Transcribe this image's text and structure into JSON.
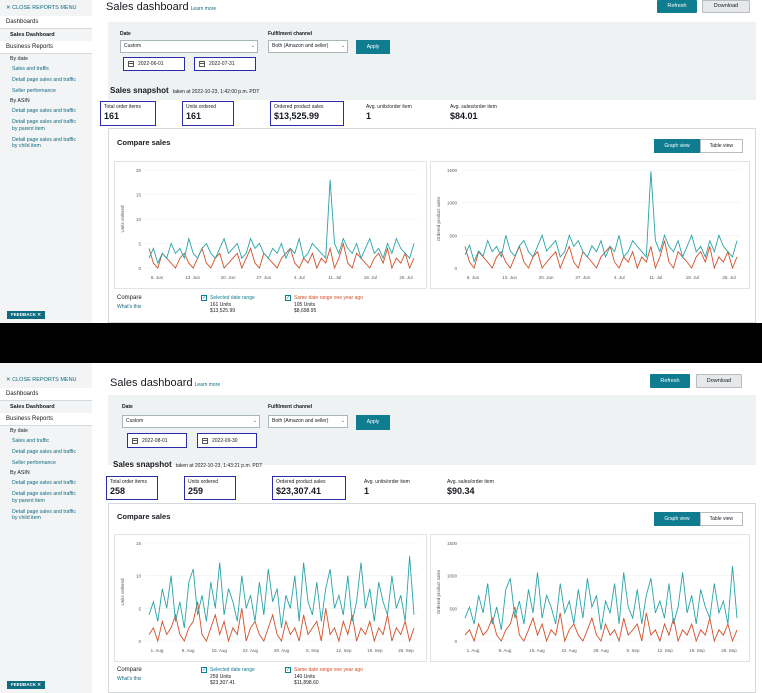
{
  "colors": {
    "teal": "#2aa3a8",
    "orange": "#d1502a",
    "accent": "#0f7c90",
    "highlight": "#2b2aa8"
  },
  "sidebar": {
    "close_label": "✕ CLOSE REPORTS MENU",
    "dashboards": "Dashboards",
    "sales_dashboard": "Sales Dashboard",
    "business_reports": "Business Reports",
    "by_date": "By date",
    "sales_and_traffic": "Sales and traffic",
    "detail_page": "Detail page sales and traffic",
    "seller_performance": "Seller performance",
    "by_asin": "By ASIN",
    "detail_page_asin": "Detail page sales and traffic",
    "detail_parent": "Detail page sales and traffic by parent item",
    "detail_child": "Detail page sales and traffic by child item",
    "feedback": "FEEDBACK ✕"
  },
  "header": {
    "title": "Sales dashboard",
    "learn_more": "Learn more",
    "refresh": "Refresh",
    "download": "Download"
  },
  "filters": {
    "date_label": "Date",
    "date_value": "Custom",
    "channel_label": "Fulfilment channel",
    "channel_value": "Both (Amazon and seller)",
    "apply": "Apply"
  },
  "snapshot": {
    "title": "Sales snapshot",
    "labels": [
      "Total order items",
      "Units ordered",
      "Ordered product sales",
      "Avg. units/order item",
      "Avg. sales/order item"
    ]
  },
  "compare": {
    "title": "Compare sales",
    "graph_view": "Graph view",
    "table_view": "Table view",
    "legend_title": "Compare",
    "whats_this": "What's this",
    "selected_label": "Selected date range",
    "previous_label": "Same date range one year ago"
  },
  "top": {
    "start_date": "2022-06-01",
    "end_date": "2022-07-31",
    "snapshot_time": "taken at 2022-10-23, 1:42:00 p.m. PDT",
    "values": [
      "161",
      "161",
      "$13,525.99",
      "1",
      "$84.01"
    ],
    "selected_units": "161 Units",
    "selected_sales": "$13,525.99",
    "previous_units": "105 Units",
    "previous_sales": "$8,698.95",
    "units_chart": {
      "ylabel": "Units ordered",
      "yticks": [
        "20",
        "15",
        "10",
        "5",
        "0"
      ],
      "xticks": [
        "6. Jun",
        "13. Jun",
        "20. Jun",
        "27. Jun",
        "4. Jul",
        "11. Jul",
        "18. Jul",
        "25. Jul"
      ]
    },
    "sales_chart": {
      "ylabel": "Ordered product sales",
      "yticks": [
        "1500",
        "1000",
        "500",
        "0"
      ],
      "xticks": [
        "6. Jun",
        "13. Jun",
        "20. Jun",
        "27. Jun",
        "4. Jul",
        "11. Jul",
        "18. Jul",
        "25. Jul"
      ]
    }
  },
  "bottom": {
    "start_date": "2022-08-01",
    "end_date": "2022-09-30",
    "snapshot_time": "taken at 2022-10-23, 1:43:21 p.m. PDT",
    "values": [
      "258",
      "259",
      "$23,307.41",
      "1",
      "$90.34"
    ],
    "selected_units": "259 Units",
    "selected_sales": "$23,307.41",
    "previous_units": "140 Units",
    "previous_sales": "$11,898.60",
    "units_chart": {
      "ylabel": "Units ordered",
      "yticks": [
        "15",
        "10",
        "5",
        "0"
      ],
      "xticks": [
        "1. Aug",
        "8. Aug",
        "15. Aug",
        "22. Aug",
        "29. Aug",
        "5. Sep",
        "12. Sep",
        "19. Sep",
        "26. Sep"
      ]
    },
    "sales_chart": {
      "ylabel": "Ordered product sales",
      "yticks": [
        "1500",
        "1000",
        "500",
        "0"
      ],
      "xticks": [
        "1. Aug",
        "8. Aug",
        "15. Aug",
        "22. Aug",
        "29. Aug",
        "5. Sep",
        "12. Sep",
        "19. Sep",
        "26. Sep"
      ]
    }
  },
  "chart_data": [
    {
      "type": "line",
      "ylabel": "Units ordered",
      "ylim": [
        0,
        20
      ],
      "x": [
        "2022-06-01",
        "2022-07-31"
      ],
      "series": [
        {
          "values": [
            2,
            4,
            1,
            3,
            2,
            5,
            3,
            4,
            2,
            6,
            3,
            2,
            4,
            5,
            3,
            2,
            4,
            6,
            3,
            4,
            5,
            2,
            3,
            6,
            4,
            5,
            3,
            2,
            4,
            3,
            5,
            2,
            4,
            3,
            6,
            2,
            3,
            5,
            4,
            3,
            2,
            18,
            5,
            3,
            6,
            4,
            3,
            5,
            2,
            4,
            6,
            3,
            4,
            2,
            5,
            3,
            6,
            4,
            3,
            2,
            5
          ]
        },
        {
          "values": [
            4,
            1,
            0,
            3,
            2,
            1,
            0,
            2,
            3,
            1,
            0,
            2,
            4,
            1,
            0,
            2,
            3,
            0,
            1,
            2,
            3,
            0,
            2,
            4,
            1,
            0,
            3,
            2,
            1,
            0,
            2,
            3,
            4,
            1,
            0,
            2,
            1,
            3,
            0,
            2,
            1,
            4,
            0,
            2,
            5,
            1,
            0,
            3,
            2,
            1,
            0,
            2,
            3,
            1,
            4,
            0,
            2,
            1,
            3,
            0,
            2
          ]
        }
      ]
    },
    {
      "type": "line",
      "ylabel": "Ordered product sales",
      "ylim": [
        0,
        1500
      ],
      "x": [
        "2022-06-01",
        "2022-07-31"
      ],
      "series": [
        {
          "values": [
            200,
            350,
            100,
            260,
            180,
            420,
            250,
            330,
            170,
            500,
            260,
            180,
            340,
            420,
            250,
            170,
            330,
            500,
            260,
            340,
            420,
            170,
            250,
            500,
            330,
            420,
            250,
            170,
            340,
            250,
            420,
            170,
            330,
            250,
            500,
            170,
            250,
            420,
            330,
            250,
            170,
            1480,
            420,
            250,
            500,
            330,
            250,
            420,
            170,
            330,
            500,
            250,
            330,
            170,
            420,
            250,
            500,
            330,
            250,
            170,
            420
          ]
        },
        {
          "values": [
            330,
            90,
            0,
            250,
            170,
            90,
            0,
            170,
            250,
            90,
            0,
            170,
            330,
            90,
            0,
            170,
            250,
            0,
            90,
            170,
            250,
            0,
            170,
            330,
            90,
            0,
            250,
            170,
            90,
            0,
            170,
            250,
            330,
            90,
            0,
            170,
            90,
            250,
            0,
            170,
            90,
            330,
            0,
            170,
            420,
            90,
            0,
            250,
            170,
            90,
            0,
            170,
            250,
            90,
            330,
            0,
            170,
            90,
            250,
            0,
            170
          ]
        }
      ]
    },
    {
      "type": "line",
      "ylabel": "Units ordered",
      "ylim": [
        0,
        15
      ],
      "x": [
        "2022-08-01",
        "2022-09-30"
      ],
      "series": [
        {
          "values": [
            4,
            6,
            3,
            8,
            5,
            10,
            3,
            6,
            2,
            9,
            11,
            4,
            7,
            3,
            9,
            5,
            12,
            4,
            8,
            6,
            3,
            10,
            5,
            7,
            3,
            9,
            4,
            11,
            6,
            8,
            2,
            7,
            5,
            10,
            3,
            12,
            6,
            4,
            9,
            3,
            8,
            11,
            5,
            7,
            4,
            10,
            3,
            6,
            12,
            5,
            8,
            3,
            9,
            6,
            4,
            10,
            5,
            7,
            3,
            13,
            4
          ]
        },
        {
          "values": [
            1,
            2,
            0,
            3,
            1,
            2,
            4,
            1,
            0,
            2,
            3,
            6,
            1,
            0,
            2,
            4,
            1,
            3,
            0,
            2,
            1,
            5,
            0,
            2,
            3,
            1,
            0,
            2,
            4,
            1,
            0,
            3,
            1,
            2,
            0,
            4,
            1,
            2,
            3,
            0,
            5,
            1,
            2,
            0,
            3,
            1,
            4,
            0,
            2,
            1,
            3,
            0,
            2,
            1,
            4,
            0,
            2,
            1,
            3,
            0,
            2
          ]
        }
      ]
    },
    {
      "type": "line",
      "ylabel": "Ordered product sales",
      "ylim": [
        0,
        1500
      ],
      "x": [
        "2022-08-01",
        "2022-09-30"
      ],
      "series": [
        {
          "values": [
            350,
            520,
            260,
            700,
            430,
            880,
            260,
            520,
            170,
            790,
            960,
            350,
            610,
            260,
            790,
            430,
            1050,
            350,
            700,
            520,
            260,
            880,
            430,
            610,
            260,
            790,
            350,
            960,
            520,
            700,
            170,
            610,
            430,
            880,
            260,
            1050,
            520,
            350,
            790,
            260,
            700,
            960,
            430,
            610,
            350,
            880,
            260,
            520,
            1050,
            430,
            700,
            260,
            790,
            520,
            350,
            880,
            430,
            610,
            260,
            1150,
            350
          ]
        },
        {
          "values": [
            90,
            170,
            0,
            260,
            90,
            170,
            350,
            90,
            0,
            170,
            260,
            520,
            90,
            0,
            170,
            350,
            90,
            260,
            0,
            170,
            90,
            430,
            0,
            170,
            260,
            90,
            0,
            170,
            350,
            90,
            0,
            260,
            90,
            170,
            0,
            350,
            90,
            170,
            260,
            0,
            430,
            90,
            170,
            0,
            260,
            90,
            350,
            0,
            170,
            90,
            260,
            0,
            170,
            90,
            350,
            0,
            170,
            90,
            260,
            0,
            170
          ]
        }
      ]
    }
  ]
}
